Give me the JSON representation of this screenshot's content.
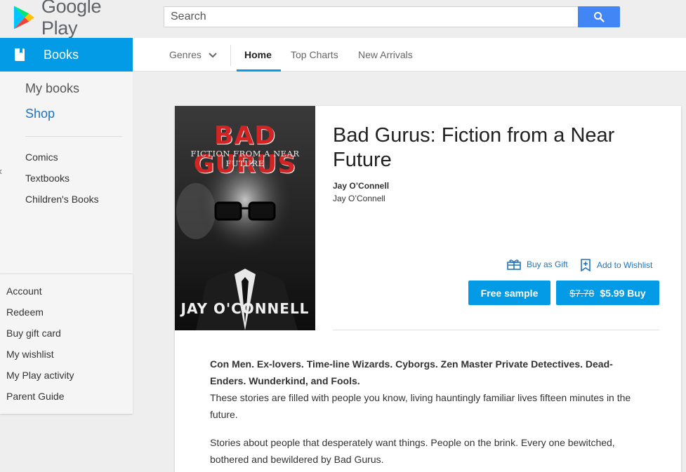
{
  "header": {
    "logo_text": "Google Play",
    "search_placeholder": "Search"
  },
  "category": {
    "title": "Books"
  },
  "nav": {
    "genres": "Genres",
    "home": "Home",
    "top_charts": "Top Charts",
    "new_arrivals": "New Arrivals"
  },
  "sidebar": {
    "my_books": "My books",
    "shop": "Shop",
    "items": [
      "Comics",
      "Textbooks",
      "Children's Books"
    ]
  },
  "account_menu": [
    "Account",
    "Redeem",
    "Buy gift card",
    "My wishlist",
    "My Play activity",
    "Parent Guide"
  ],
  "book": {
    "cover_title": "BAD GURUS",
    "cover_subtitle": "FICTION FROM A NEAR FUTURE",
    "cover_author": "JAY O'CONNELL",
    "title": "Bad Gurus: Fiction from a Near Future",
    "author_bold": "Jay O’Connell",
    "author_plain": "Jay O’Connell",
    "buy_as_gift": "Buy as Gift",
    "add_to_wishlist": "Add to Wishlist",
    "free_sample": "Free sample",
    "old_price": "$7.78",
    "buy_label": "$5.99 Buy",
    "description_bold": "Con Men. Ex-lovers. Time-line Wizards. Cyborgs. Zen Master Private Detectives. Dead-Enders. Wunderkind, and Fools.",
    "description_1": "These stories are filled with people you know, living hauntingly familiar lives fifteen minutes in the future.",
    "description_2": "Stories about people that desperately want things. People on the brink. Every one bewitched, bothered and bewildered by Bad Gurus."
  },
  "colors": {
    "accent": "#039be5",
    "search_button": "#4285f4",
    "link": "#1e73be"
  }
}
